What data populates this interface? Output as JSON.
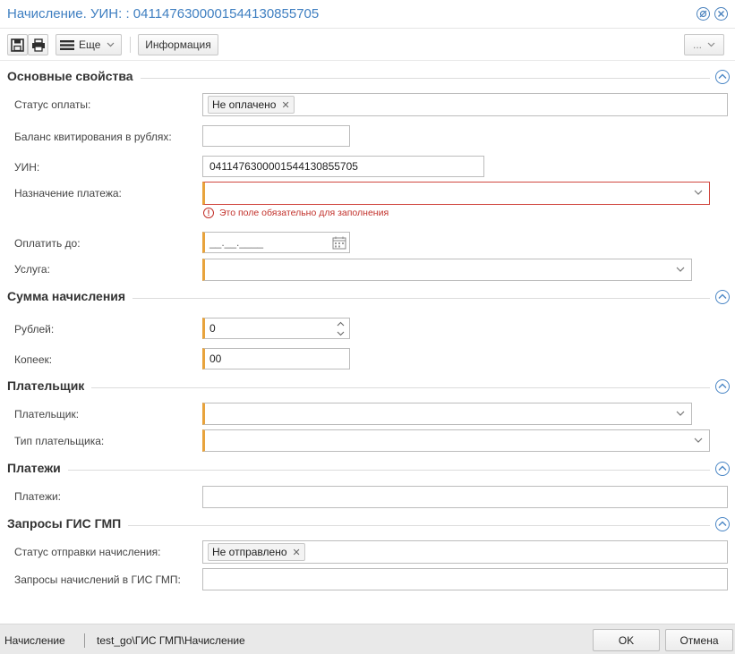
{
  "window": {
    "title": "Начисление. УИН: : 0411476300001544130855705"
  },
  "toolbar": {
    "more_label": "Еще",
    "info_label": "Информация",
    "ellipsis_label": "..."
  },
  "sections": {
    "main": {
      "title": "Основные свойства",
      "payment_status_label": "Статус оплаты:",
      "payment_status_tag": "Не оплачено",
      "balance_label": "Баланс квитирования в рублях:",
      "balance_value": "",
      "uin_label": "УИН:",
      "uin_value": "0411476300001544130855705",
      "purpose_label": "Назначение платежа:",
      "purpose_value": "",
      "purpose_error": "Это поле обязательно для заполнения",
      "pay_until_label": "Оплатить до:",
      "pay_until_placeholder": "__.__.____",
      "service_label": "Услуга:",
      "service_value": ""
    },
    "amount": {
      "title": "Сумма начисления",
      "rubles_label": "Рублей:",
      "rubles_value": "0",
      "kopecks_label": "Копеек:",
      "kopecks_value": "00"
    },
    "payer": {
      "title": "Плательщик",
      "payer_label": "Плательщик:",
      "payer_value": "",
      "payer_type_label": "Тип плательщика:",
      "payer_type_value": ""
    },
    "payments": {
      "title": "Платежи",
      "payments_label": "Платежи:",
      "payments_value": ""
    },
    "gis": {
      "title": "Запросы ГИС ГМП",
      "send_status_label": "Статус отправки начисления:",
      "send_status_tag": "Не отправлено",
      "requests_label": "Запросы начислений в ГИС ГМП:",
      "requests_value": ""
    }
  },
  "status_bar": {
    "left_text": "Начисление",
    "path_text": "test_go\\ГИС ГМП\\Начисление",
    "ok_label": "OK",
    "cancel_label": "Отмена"
  },
  "colors": {
    "accent": "#3f7fc1",
    "required_marker": "#e8a33c",
    "error": "#c2312b"
  }
}
